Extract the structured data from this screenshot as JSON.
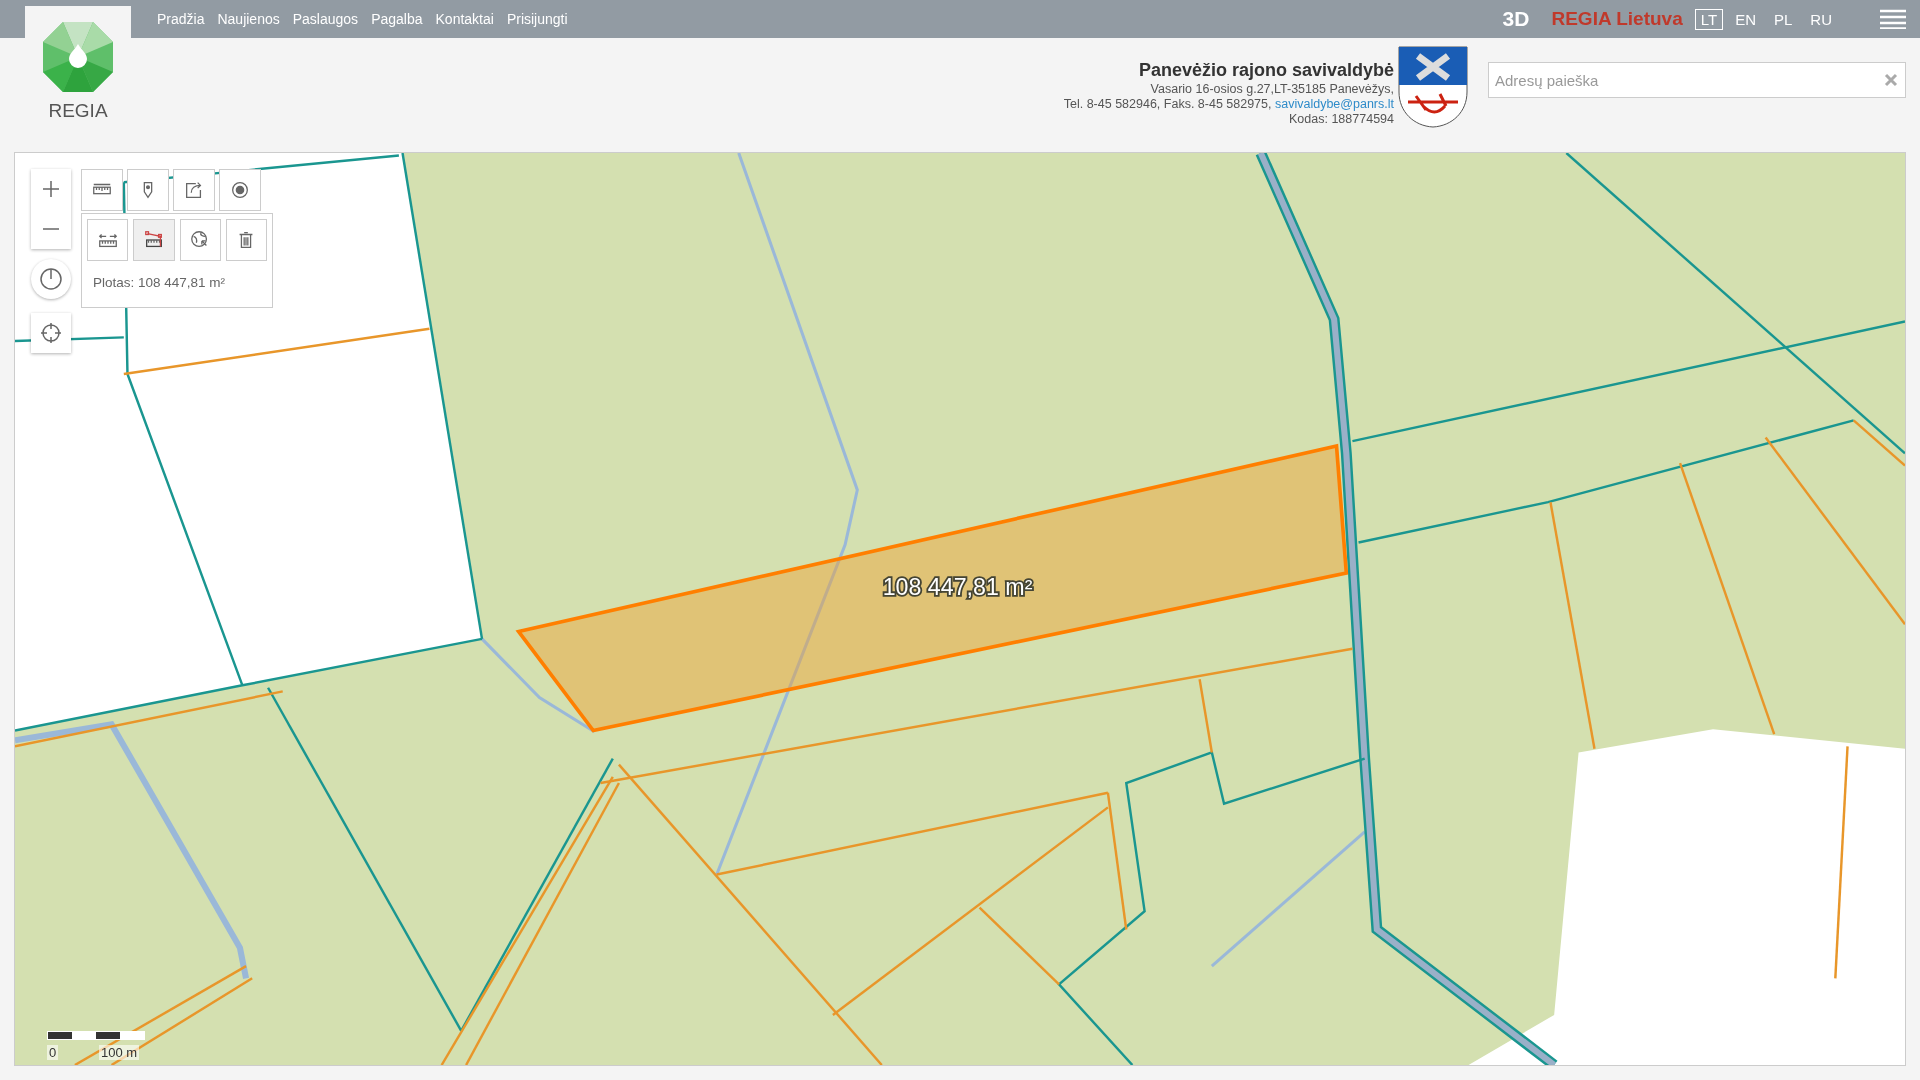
{
  "logo": {
    "text": "REGIA"
  },
  "nav": [
    "Pradžia",
    "Naujienos",
    "Paslaugos",
    "Pagalba",
    "Kontaktai",
    "Prisijungti"
  ],
  "top_right": {
    "mode": "3D",
    "brand": "REGIA Lietuva",
    "languages": [
      {
        "label": "LT",
        "selected": true
      },
      {
        "label": "EN",
        "selected": false
      },
      {
        "label": "PL",
        "selected": false
      },
      {
        "label": "RU",
        "selected": false
      }
    ]
  },
  "municipality": {
    "name": "Panevėžio rajono savivaldybė",
    "address": "Vasario 16-osios g.27,LT-35185 Panevėžys,",
    "phones": "Tel. 8-45 582946, Faks. 8-45 582975,",
    "email": "savivaldybe@panrs.lt",
    "code": "Kodas: 188774594"
  },
  "search": {
    "placeholder": "Adresų paieška"
  },
  "map": {
    "tools": [
      {
        "kind": "ruler",
        "selected": false
      },
      {
        "kind": "pin",
        "selected": false
      },
      {
        "kind": "share",
        "selected": false
      },
      {
        "kind": "record",
        "selected": false
      }
    ],
    "measure_tools": [
      {
        "kind": "distance",
        "selected": false
      },
      {
        "kind": "area",
        "selected": true
      },
      {
        "kind": "globe",
        "selected": false
      },
      {
        "kind": "delete",
        "selected": false
      }
    ],
    "measure_result": "Plotas: 108 447,81 m²",
    "area_label": "108 447,81 m²",
    "scale": {
      "zero": "0",
      "distance": "100 m"
    }
  }
}
